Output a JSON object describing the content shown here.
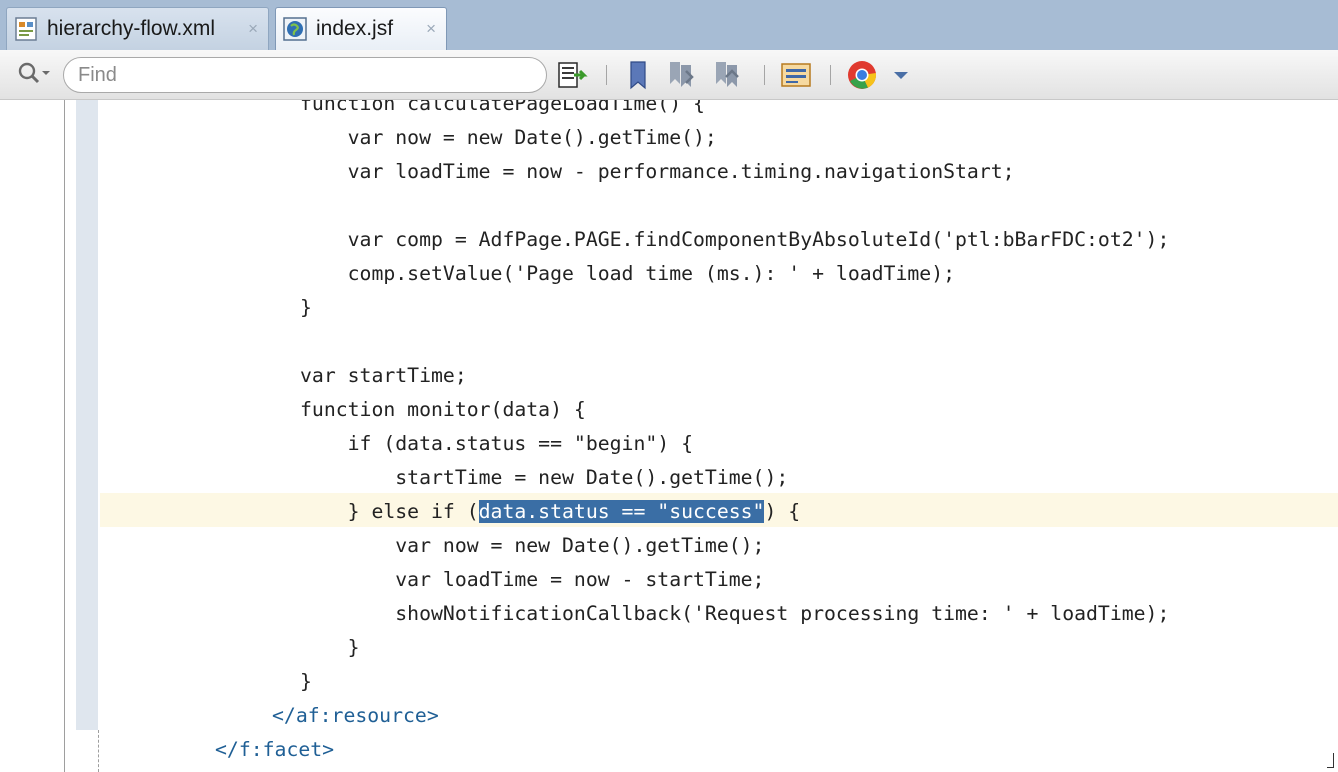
{
  "tabs": [
    {
      "label": "hierarchy-flow.xml",
      "icon": "xml-file-icon",
      "close": "×",
      "active": false
    },
    {
      "label": "index.jsf",
      "icon": "globe-page-icon",
      "close": "×",
      "active": true
    }
  ],
  "toolbar": {
    "find_placeholder": "Find",
    "buttons": [
      "toggle-line-numbers-icon",
      "bookmark-icon",
      "next-bookmark-icon",
      "previous-bookmark-icon",
      "source-view-icon",
      "chrome-browser-icon",
      "dropdown-arrow-icon"
    ]
  },
  "editor": {
    "lines": [
      {
        "pre": "function calculatePageLoadTime() {"
      },
      {
        "pre": "    var now = new Date().getTime();"
      },
      {
        "pre": "    var loadTime = now - performance.timing.navigationStart;"
      },
      {
        "pre": ""
      },
      {
        "pre": "    var comp = AdfPage.PAGE.findComponentByAbsoluteId('ptl:bBarFDC:ot2');"
      },
      {
        "pre": "    comp.setValue('Page load time (ms.): ' + loadTime);"
      },
      {
        "pre": "}"
      },
      {
        "pre": ""
      },
      {
        "pre": "var startTime;"
      },
      {
        "pre": "function monitor(data) {"
      },
      {
        "pre": "    if (data.status == \"begin\") {"
      },
      {
        "pre": "        startTime = new Date().getTime();"
      },
      {
        "pre": "    } else if (",
        "sel": "data.status == \"success\"",
        "post": ") {"
      },
      {
        "pre": "        var now = new Date().getTime();"
      },
      {
        "pre": "        var loadTime = now - startTime;"
      },
      {
        "pre": "        showNotificationCallback('Request processing time: ' + loadTime);"
      },
      {
        "pre": "    }"
      },
      {
        "pre": "}"
      }
    ],
    "tag_lines": [
      {
        "text": "</af:resource>"
      },
      {
        "text": "</f:facet>"
      }
    ]
  }
}
